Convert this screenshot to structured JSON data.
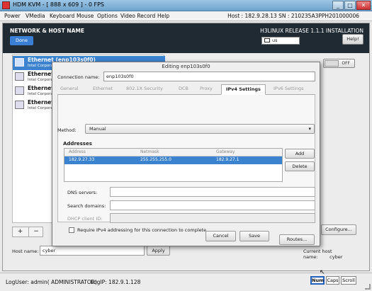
{
  "window": {
    "title": "HDM KVM - [ 888 x 609 ] - 0 FPS",
    "min_glyph": "_",
    "max_glyph": "□",
    "close_glyph": "✕"
  },
  "kvm_menu": {
    "items": [
      "Power",
      "VMedia",
      "Keyboard",
      "Mouse",
      "Options",
      "Video Record",
      "Help"
    ],
    "host_info": "Host : 182.9.28.13  SN : 210235A3PPH201000006"
  },
  "anaconda": {
    "spoke_title": "NETWORK & HOST NAME",
    "done_label": "Done",
    "release": "H3LINUX RELEASE 1.1.1 INSTALLATION",
    "keyboard_layout": "us",
    "help_label": "Help!",
    "toggle_state": "OFF",
    "devices": [
      {
        "name": "Ethernet (enp103s0f0)",
        "desc": "Intel Corporation"
      },
      {
        "name": "Ethernet (e",
        "desc": "Intel Corporatio"
      },
      {
        "name": "Ethernet (e",
        "desc": "Intel Corporatio"
      },
      {
        "name": "Ethernet (e",
        "desc": "Intel Corporatio"
      }
    ],
    "add_glyph": "+",
    "remove_glyph": "−",
    "configure_label": "Configure...",
    "host_name_label": "Host name:",
    "host_name_value": "cyber",
    "apply_label": "Apply",
    "current_host_label": "Current host name:",
    "current_host_value": "cyber"
  },
  "dialog": {
    "title": "Editing enp103s0f0",
    "connection_name_label": "Connection name:",
    "connection_name_value": "enp103s0f0",
    "tabs": [
      "General",
      "Ethernet",
      "802.1X Security",
      "DCB",
      "Proxy",
      "IPv4 Settings",
      "IPv6 Settings"
    ],
    "active_tab": "IPv4 Settings",
    "method_label": "Method:",
    "method_value": "Manual",
    "method_arrow": "▾",
    "addresses_label": "Addresses",
    "address_columns": [
      "Address",
      "Netmask",
      "Gateway"
    ],
    "address_rows": [
      {
        "address": "182.9.27.33",
        "netmask": "255.255.255.0",
        "gateway": "182.9.27.1"
      }
    ],
    "add_label": "Add",
    "delete_label": "Delete",
    "dns_label": "DNS servers:",
    "search_label": "Search domains:",
    "dhcp_label": "DHCP client ID:",
    "require_label": "Require IPv4 addressing for this connection to complete",
    "routes_label": "Routes...",
    "cancel_label": "Cancel",
    "save_label": "Save"
  },
  "statusbar": {
    "log_user": "LogUser: admin( ADMINISTRATOR)",
    "log_ip": "LogIP: 182.9.1.128",
    "indicators": [
      "Num",
      "Caps",
      "Scroll"
    ],
    "active_indicator": "Num",
    "cursor_glyph": "↖"
  },
  "colors": {
    "selection": "#3b82cf",
    "header_bg": "#1f2a33",
    "done_button": "#3b7fd4"
  }
}
